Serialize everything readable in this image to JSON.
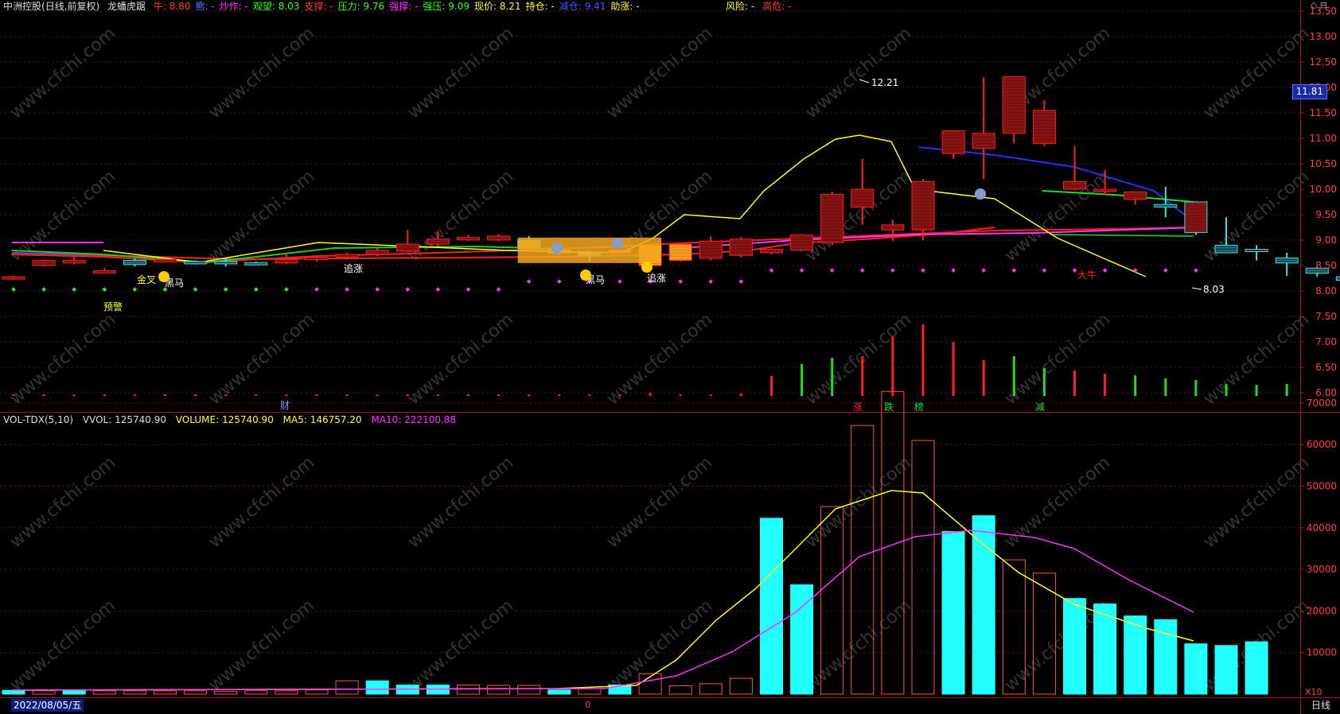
{
  "header": {
    "title": "中洲控股",
    "title_suffix": "(日线,前复权)",
    "indicator": "龙蟠虎踞",
    "fields": [
      {
        "label": "牛:",
        "value": "8.80",
        "color": "#ff3b3b"
      },
      {
        "label": "熊:",
        "value": "-",
        "color": "#6a7cff"
      },
      {
        "label": "炒作:",
        "value": "-",
        "color": "#ff33ff"
      },
      {
        "label": "观望:",
        "value": "8.03",
        "color": "#33ff33"
      },
      {
        "label": "支撑:",
        "value": "-",
        "color": "#ff3b3b"
      },
      {
        "label": "压力:",
        "value": "9.76",
        "color": "#33ff33"
      },
      {
        "label": "强撑:",
        "value": "-",
        "color": "#ff33ff"
      },
      {
        "label": "强压:",
        "value": "9.09",
        "color": "#33ff33"
      },
      {
        "label": "现价:",
        "value": "8.21",
        "color": "#ffff33"
      },
      {
        "label": "持仓:",
        "value": "-",
        "color": "#ffff33"
      },
      {
        "label": "减仓:",
        "value": "9.41",
        "color": "#4455ff"
      },
      {
        "label": "助涨:",
        "value": "-",
        "color": "#ffff33"
      }
    ],
    "risk_fields": [
      {
        "label": "风险:",
        "value": "-",
        "color": "#ffff33"
      },
      {
        "label": "高危:",
        "value": "-",
        "color": "#ff3b3b"
      }
    ],
    "corner_icons": "◇ ⊟"
  },
  "price_axis": {
    "ticks": [
      "13.50",
      "13.00",
      "12.50",
      "12.00",
      "11.50",
      "11.00",
      "10.50",
      "10.00",
      "9.50",
      "9.00",
      "8.50",
      "8.00",
      "7.50",
      "7.00",
      "6.50",
      "6.00"
    ],
    "current_price_tag": "11.81"
  },
  "volume_panel": {
    "name": "VOL-TDX(5,10)",
    "vvol_label": "VVOL:",
    "vvol_value": "125740.90",
    "volume_label": "VOLUME:",
    "volume_value": "125740.90",
    "ma5_label": "MA5:",
    "ma5_value": "146757.20",
    "ma10_label": "MA10:",
    "ma10_value": "222100.88",
    "axis_ticks": [
      "70000",
      "60000",
      "50000",
      "40000",
      "30000",
      "20000",
      "10000"
    ],
    "axis_unit": "X10"
  },
  "annotations": {
    "high_label": "12.21",
    "low_label": "8.03",
    "jincha": "金叉",
    "heima1": "黑马",
    "yujing": "预警",
    "zhuizhang1": "追涨",
    "heima2": "黑马",
    "zhuizhang2": "追涨",
    "danniu": "大牛",
    "cai": "财",
    "zhang": "涨",
    "die": "跌",
    "bang": "榜",
    "jian": "减"
  },
  "footer": {
    "date": "2022/08/05/五",
    "period": "日线",
    "marker": "0"
  },
  "watermark": "www.cfchi.com",
  "chart_data": {
    "type": "candlestick",
    "series": [
      {
        "name": "K",
        "values": [
          [
            8.25,
            8.28,
            8.22,
            8.3
          ],
          [
            8.5,
            8.6,
            8.48,
            8.62
          ],
          [
            8.55,
            8.6,
            8.52,
            8.68
          ],
          [
            8.38,
            8.4,
            8.34,
            8.45
          ],
          [
            8.6,
            8.52,
            8.48,
            8.64
          ],
          [
            8.6,
            8.62,
            8.56,
            8.64
          ],
          [
            8.58,
            8.56,
            8.52,
            8.6
          ],
          [
            8.58,
            8.56,
            8.48,
            8.64
          ],
          [
            8.56,
            8.55,
            8.53,
            8.58
          ],
          [
            8.55,
            8.62,
            8.53,
            8.72
          ],
          [
            8.62,
            8.66,
            8.58,
            8.7
          ],
          [
            8.66,
            8.72,
            8.62,
            8.75
          ],
          [
            8.72,
            8.8,
            8.68,
            8.84
          ],
          [
            8.78,
            8.92,
            8.76,
            9.2
          ],
          [
            8.92,
            9.02,
            8.88,
            9.18
          ],
          [
            9.02,
            9.05,
            8.98,
            9.1
          ],
          [
            9.0,
            9.08,
            8.98,
            9.12
          ],
          [
            9.0,
            8.84,
            8.8,
            9.08
          ],
          [
            8.8,
            8.75,
            8.72,
            8.84
          ],
          [
            8.75,
            8.7,
            8.58,
            8.8
          ],
          [
            8.75,
            8.8,
            8.72,
            8.86
          ],
          [
            8.5,
            8.9,
            8.48,
            8.95
          ],
          [
            8.6,
            8.92,
            8.58,
            8.95
          ],
          [
            8.64,
            8.98,
            8.6,
            9.08
          ],
          [
            8.7,
            9.02,
            8.66,
            9.06
          ],
          [
            8.75,
            8.82,
            8.72,
            8.84
          ],
          [
            8.8,
            9.1,
            8.78,
            9.12
          ],
          [
            8.95,
            9.9,
            8.9,
            9.95
          ],
          [
            9.65,
            10.0,
            9.3,
            10.6
          ],
          [
            9.2,
            9.3,
            8.98,
            9.4
          ],
          [
            9.2,
            10.15,
            9.0,
            10.2
          ],
          [
            10.7,
            11.15,
            10.6,
            11.15
          ],
          [
            10.8,
            11.1,
            10.2,
            12.2
          ],
          [
            11.1,
            12.21,
            10.9,
            12.21
          ],
          [
            10.9,
            11.55,
            10.85,
            11.75
          ],
          [
            10.0,
            10.15,
            9.98,
            10.85
          ],
          [
            9.98,
            10.0,
            9.88,
            10.38
          ],
          [
            9.8,
            9.95,
            9.7,
            9.95
          ],
          [
            9.7,
            9.65,
            9.45,
            10.05
          ],
          [
            9.15,
            9.75,
            9.1,
            9.75
          ],
          [
            8.9,
            8.75,
            8.75,
            9.45
          ],
          [
            8.8,
            8.82,
            8.6,
            8.9
          ],
          [
            8.65,
            8.55,
            8.3,
            8.75
          ],
          [
            8.45,
            8.35,
            8.28,
            8.48
          ],
          [
            8.28,
            8.21,
            8.03,
            8.34
          ]
        ]
      },
      {
        "name": "VOLUME",
        "values": [
          900,
          800,
          900,
          800,
          800,
          800,
          800,
          700,
          900,
          800,
          1000,
          3200,
          3200,
          2200,
          2200,
          2200,
          2100,
          2100,
          1000,
          1300,
          2200,
          4900,
          2000,
          2500,
          3800,
          42300,
          26300,
          45100,
          64600,
          72800,
          61000,
          39100,
          42900,
          32300,
          29100,
          23000,
          21700,
          18800,
          17900,
          12100,
          11700,
          12600
        ]
      },
      {
        "name": "MA5",
        "values": []
      },
      {
        "name": "MA10",
        "values": []
      }
    ],
    "ylim_price": [
      5.75,
      13.75
    ],
    "ylim_volume": [
      0,
      75000
    ]
  }
}
